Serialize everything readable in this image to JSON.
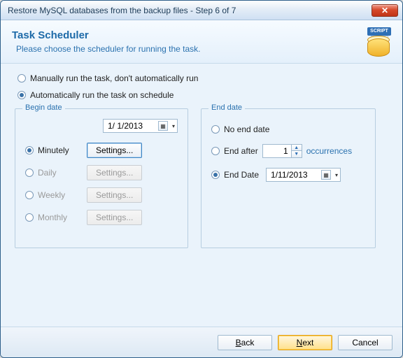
{
  "window": {
    "title": "Restore MySQL databases from the backup files - Step 6 of 7"
  },
  "header": {
    "title": "Task Scheduler",
    "subtitle": "Please choose the scheduler for running the task.",
    "icon_script": "SCRIPT",
    "icon_sql": "SQL"
  },
  "mode": {
    "manual_label": "Manually run the task, don't automatically run",
    "auto_label": "Automatically run the task on schedule",
    "selected": "auto"
  },
  "begin": {
    "legend": "Begin date",
    "date_value": "1/ 1/2013",
    "freq_selected": "minutely",
    "options": {
      "minutely": "Minutely",
      "daily": "Daily",
      "weekly": "Weekly",
      "monthly": "Monthly"
    },
    "settings_label": "Settings..."
  },
  "end": {
    "legend": "End date",
    "selected": "end_date",
    "no_end_label": "No end date",
    "end_after_label": "End after",
    "occurrences_value": "1",
    "occurrences_label": "occurrences",
    "end_date_label": "End Date",
    "end_date_value": "1/11/2013"
  },
  "footer": {
    "back": "Back",
    "next": "Next",
    "cancel": "Cancel"
  }
}
